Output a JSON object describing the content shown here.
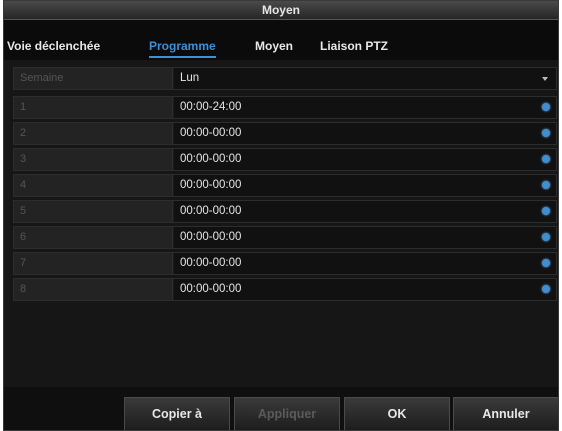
{
  "window": {
    "title": "Moyen"
  },
  "tabs": [
    {
      "label": "Voie déclenchée",
      "active": false
    },
    {
      "label": "Programme",
      "active": true
    },
    {
      "label": "Moyen",
      "active": false
    },
    {
      "label": "Liaison PTZ",
      "active": false
    }
  ],
  "week": {
    "label": "Semaine",
    "value": "Lun"
  },
  "schedule": [
    {
      "index": "1",
      "time": "00:00-24:00"
    },
    {
      "index": "2",
      "time": "00:00-00:00"
    },
    {
      "index": "3",
      "time": "00:00-00:00"
    },
    {
      "index": "4",
      "time": "00:00-00:00"
    },
    {
      "index": "5",
      "time": "00:00-00:00"
    },
    {
      "index": "6",
      "time": "00:00-00:00"
    },
    {
      "index": "7",
      "time": "00:00-00:00"
    },
    {
      "index": "8",
      "time": "00:00-00:00"
    }
  ],
  "buttons": {
    "copy": "Copier à",
    "apply": "Appliquer",
    "ok": "OK",
    "cancel": "Annuler"
  },
  "colors": {
    "accent": "#3d8fd6",
    "background": "#141414",
    "disabled_text": "#5b5b5b"
  }
}
